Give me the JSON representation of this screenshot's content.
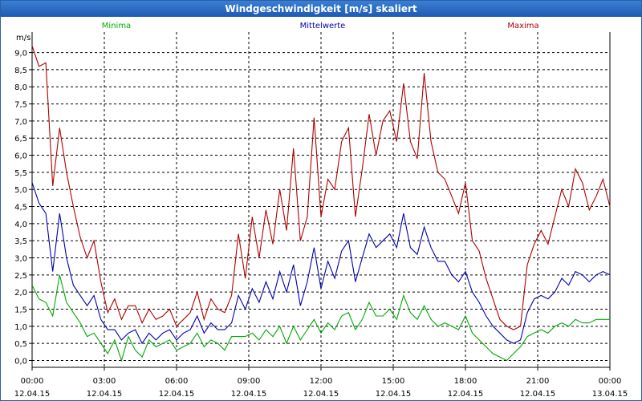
{
  "window": {
    "title": "Windgeschwindigkeit [m/s] skaliert"
  },
  "chart_data": {
    "type": "line",
    "title": "Windgeschwindigkeit [m/s] skaliert",
    "ylabel": "m/s",
    "ylim": [
      -0.2,
      9.6
    ],
    "grid": true,
    "legend_placement": "top",
    "y_ticks": [
      "0,0",
      "0,5",
      "1,0",
      "1,5",
      "2,0",
      "2,5",
      "3,0",
      "3,5",
      "4,0",
      "4,5",
      "5,0",
      "5,5",
      "6,0",
      "6,5",
      "7,0",
      "7,5",
      "8,0",
      "8,5",
      "9,0"
    ],
    "x_ticks": [
      {
        "time": "00:00",
        "date": "12.04.15"
      },
      {
        "time": "03:00",
        "date": "12.04.15"
      },
      {
        "time": "06:00",
        "date": "12.04.15"
      },
      {
        "time": "09:00",
        "date": "12.04.15"
      },
      {
        "time": "12:00",
        "date": "12.04.15"
      },
      {
        "time": "15:00",
        "date": "12.04.15"
      },
      {
        "time": "18:00",
        "date": "12.04.15"
      },
      {
        "time": "21:00",
        "date": "12.04.15"
      },
      {
        "time": "00:00",
        "date": "13.04.15"
      }
    ],
    "x_hours": [
      0,
      0.5,
      1,
      1.5,
      2,
      2.5,
      3,
      3.5,
      4,
      4.5,
      5,
      5.5,
      6,
      6.5,
      7,
      7.5,
      8,
      8.5,
      9,
      9.5,
      10,
      10.5,
      11,
      11.5,
      12,
      12.5,
      13,
      13.5,
      14,
      14.5,
      15,
      15.5,
      16,
      16.5,
      17,
      17.5,
      18,
      18.5,
      19,
      19.5,
      20,
      20.5,
      21,
      21.5,
      22,
      22.5,
      23,
      23.5,
      24
    ],
    "series": [
      {
        "name": "Maxima",
        "color": "#b00000",
        "values": [
          9.2,
          8.6,
          8.7,
          5.1,
          6.8,
          5.5,
          4.5,
          3.6,
          3.0,
          3.5,
          2.3,
          1.4,
          1.8,
          1.2,
          1.6,
          1.6,
          1.1,
          1.5,
          1.2,
          1.3,
          1.5,
          1.0,
          1.2,
          1.4,
          2.0,
          1.2,
          1.8,
          1.5,
          1.4,
          1.9,
          3.7,
          2.4,
          4.2,
          3.0,
          4.4,
          3.4,
          5.0,
          3.8,
          6.2,
          3.5,
          4.2,
          7.1,
          4.2,
          5.3,
          5.0,
          6.4,
          6.8,
          4.2,
          5.6,
          7.2,
          6.0,
          7.0,
          7.3,
          6.4,
          8.1,
          6.4,
          5.9,
          8.4,
          6.4,
          5.5,
          5.3,
          4.8,
          4.3,
          5.2,
          3.5,
          3.2,
          2.4,
          1.8,
          1.2,
          1.0,
          0.9,
          1.0,
          2.8,
          3.4,
          3.8,
          3.4,
          4.2,
          5.0,
          4.5,
          5.6,
          5.2,
          4.4,
          4.8,
          5.3,
          4.5
        ]
      },
      {
        "name": "Mittelwerte",
        "color": "#0000b0",
        "values": [
          5.2,
          4.6,
          4.3,
          2.6,
          4.3,
          3.0,
          2.2,
          1.9,
          1.6,
          1.9,
          1.2,
          0.9,
          0.9,
          0.6,
          0.8,
          0.9,
          0.5,
          0.8,
          0.6,
          0.8,
          0.9,
          0.6,
          0.8,
          0.9,
          1.3,
          0.8,
          1.1,
          0.9,
          0.9,
          1.1,
          1.9,
          1.5,
          2.1,
          1.7,
          2.3,
          1.8,
          2.6,
          2.0,
          2.8,
          1.6,
          2.3,
          3.3,
          2.1,
          2.9,
          2.4,
          3.2,
          3.5,
          2.3,
          3.0,
          3.7,
          3.3,
          3.5,
          3.7,
          3.3,
          4.3,
          3.3,
          3.1,
          3.9,
          3.3,
          2.9,
          2.9,
          2.5,
          2.3,
          2.6,
          2.0,
          1.7,
          1.3,
          1.0,
          0.8,
          0.6,
          0.5,
          0.6,
          1.4,
          1.8,
          1.9,
          1.8,
          2.0,
          2.4,
          2.2,
          2.6,
          2.5,
          2.3,
          2.5,
          2.6,
          2.5
        ]
      },
      {
        "name": "Minima",
        "color": "#00aa00",
        "values": [
          2.2,
          1.8,
          1.7,
          1.3,
          2.5,
          1.7,
          1.4,
          1.1,
          0.7,
          0.8,
          0.5,
          0.2,
          0.6,
          0.0,
          0.7,
          0.3,
          0.1,
          0.6,
          0.4,
          0.5,
          0.6,
          0.3,
          0.4,
          0.5,
          0.8,
          0.4,
          0.6,
          0.5,
          0.3,
          0.7,
          0.7,
          0.7,
          0.8,
          0.6,
          0.9,
          0.7,
          1.0,
          0.5,
          1.0,
          0.6,
          0.9,
          1.2,
          0.8,
          1.1,
          0.9,
          1.3,
          1.4,
          0.9,
          1.2,
          1.7,
          1.3,
          1.3,
          1.5,
          1.2,
          1.9,
          1.4,
          1.2,
          1.6,
          1.2,
          1.0,
          1.1,
          1.0,
          0.9,
          1.3,
          0.8,
          0.6,
          0.4,
          0.2,
          0.1,
          0.0,
          0.2,
          0.4,
          0.7,
          0.8,
          0.9,
          0.8,
          1.0,
          1.1,
          1.0,
          1.2,
          1.1,
          1.1,
          1.2,
          1.2,
          1.2
        ]
      }
    ]
  }
}
